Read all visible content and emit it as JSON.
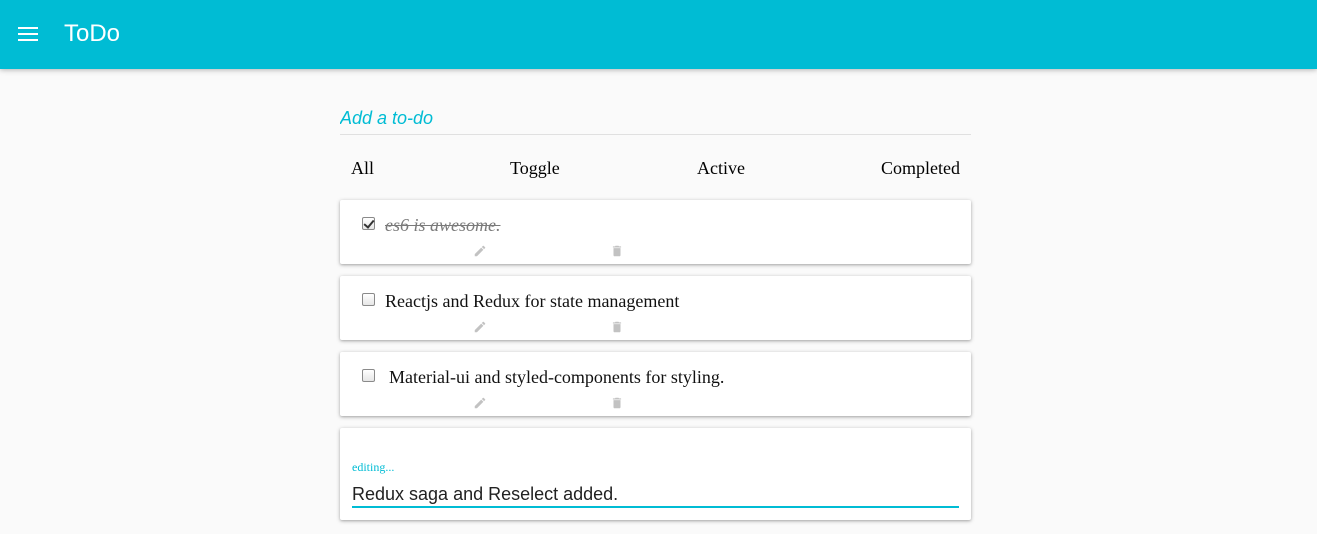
{
  "appbar": {
    "title": "ToDo",
    "menu_icon": "hamburger-menu-icon",
    "color": "#00bcd4"
  },
  "add_todo": {
    "placeholder": "Add a to-do",
    "value": ""
  },
  "filters": {
    "all": "All",
    "toggle": "Toggle",
    "active": "Active",
    "completed": "Completed"
  },
  "todos": [
    {
      "text": "es6 is awesome.",
      "completed": true,
      "edit_icon": "pencil-icon",
      "delete_icon": "trash-icon"
    },
    {
      "text": "Reactjs and Redux for state management",
      "completed": false,
      "edit_icon": "pencil-icon",
      "delete_icon": "trash-icon"
    },
    {
      "text": "Material-ui and styled-components for styling.",
      "completed": false,
      "edit_icon": "pencil-icon",
      "delete_icon": "trash-icon"
    }
  ],
  "editing": {
    "label": "editing...",
    "value": "Redux saga and Reselect added."
  }
}
